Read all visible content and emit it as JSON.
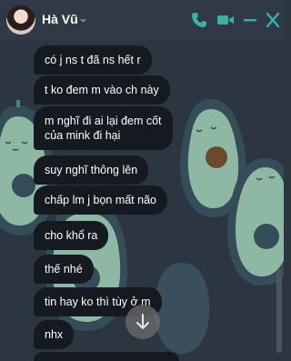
{
  "header": {
    "contact_name": "Hà Vũ",
    "icons": [
      "avatar",
      "chevron-down-icon",
      "phone-icon",
      "video-icon",
      "minimize-icon",
      "close-icon"
    ],
    "accent_color": "#3bb0a8"
  },
  "messages": [
    {
      "text": "có j ns t đã ns hết r"
    },
    {
      "text": "t ko đem m vào ch này"
    },
    {
      "line1": "m nghĩ đi ai lại đem cốt",
      "line2": "của mink đi hại"
    },
    {
      "text": "suy nghĩ thông lên"
    },
    {
      "text": "chấp lm j bọn mất não"
    },
    {
      "text": "cho khổ ra"
    },
    {
      "text": "thế nhé"
    },
    {
      "text": "tin hay ko thì tùy ở m"
    },
    {
      "text": "nhx"
    }
  ],
  "scroll_button": {
    "icon": "arrow-down-icon"
  }
}
